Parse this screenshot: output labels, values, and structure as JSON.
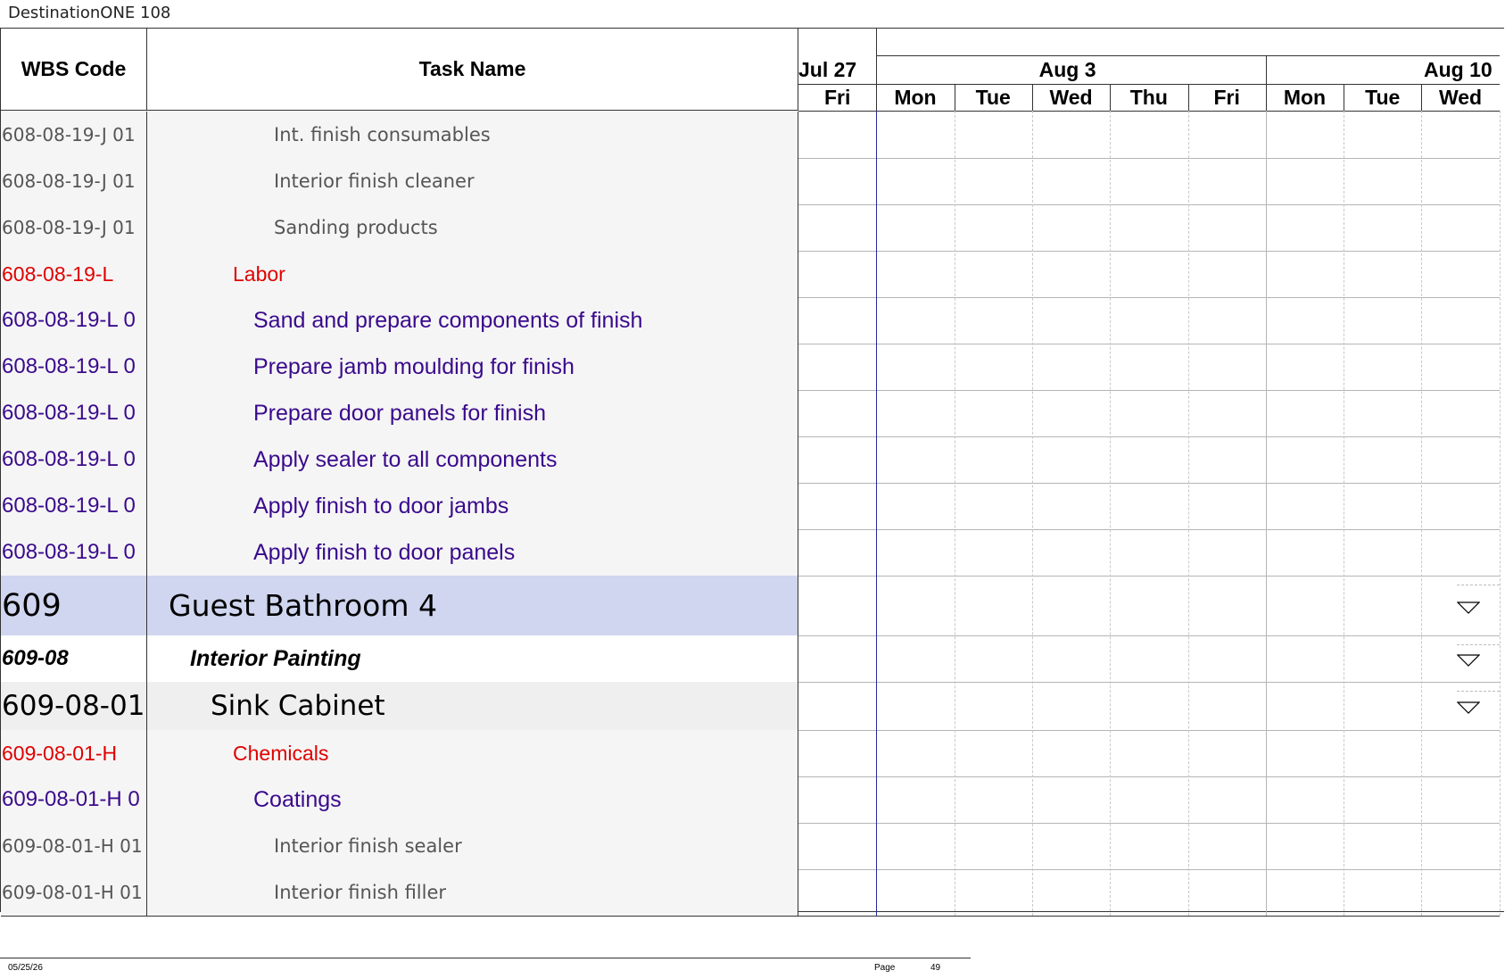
{
  "document": {
    "title": "DestinationONE 108"
  },
  "columns": {
    "wbs_header": "WBS Code",
    "task_header": "Task Name"
  },
  "timeline": {
    "weeks": [
      "Jul 27",
      "Aug 3",
      "Aug 10"
    ],
    "days": [
      "Fri",
      "Mon",
      "Tue",
      "Wed",
      "Thu",
      "Fri",
      "Mon",
      "Tue",
      "Wed"
    ]
  },
  "rows": [
    {
      "wbs": "608-08-19-J 01",
      "task": "Int. finish consumables",
      "style": "leaf",
      "collapse_icon": false
    },
    {
      "wbs": "608-08-19-J 01",
      "task": "Interior finish cleaner",
      "style": "leaf",
      "collapse_icon": false
    },
    {
      "wbs": "608-08-19-J 01",
      "task": "Sanding products",
      "style": "leaf",
      "collapse_icon": false
    },
    {
      "wbs": "608-08-19-L",
      "task": "Labor",
      "style": "category",
      "collapse_icon": false
    },
    {
      "wbs": "608-08-19-L 0",
      "task": "Sand and prepare components of finish",
      "style": "item",
      "collapse_icon": false
    },
    {
      "wbs": "608-08-19-L 0",
      "task": "Prepare jamb moulding for finish",
      "style": "item",
      "collapse_icon": false
    },
    {
      "wbs": "608-08-19-L 0",
      "task": "Prepare door panels for finish",
      "style": "item",
      "collapse_icon": false
    },
    {
      "wbs": "608-08-19-L 0",
      "task": "Apply sealer to all components",
      "style": "item",
      "collapse_icon": false
    },
    {
      "wbs": "608-08-19-L 0",
      "task": "Apply finish to door jambs",
      "style": "item",
      "collapse_icon": false
    },
    {
      "wbs": "608-08-19-L 0",
      "task": "Apply finish to door panels",
      "style": "item",
      "collapse_icon": false
    },
    {
      "wbs": "609",
      "task": "Guest Bathroom 4",
      "style": "room",
      "collapse_icon": true
    },
    {
      "wbs": "609-08",
      "task": "Interior Painting",
      "style": "phase",
      "collapse_icon": true
    },
    {
      "wbs": "609-08-01",
      "task": "Sink Cabinet",
      "style": "group",
      "collapse_icon": true
    },
    {
      "wbs": "609-08-01-H",
      "task": "Chemicals",
      "style": "category",
      "collapse_icon": false
    },
    {
      "wbs": "609-08-01-H 0",
      "task": "Coatings",
      "style": "item",
      "collapse_icon": false
    },
    {
      "wbs": "609-08-01-H 01",
      "task": "Interior finish sealer",
      "style": "leaf",
      "collapse_icon": false
    },
    {
      "wbs": "609-08-01-H 01",
      "task": "Interior finish filler",
      "style": "leaf",
      "collapse_icon": false
    }
  ],
  "colors": {
    "leaf": "#555555",
    "category": "#e00000",
    "item": "#3a0a8c",
    "room_fill": "#d0d6ef",
    "group_fill": "#efefef",
    "gridline": "#b5b5b5",
    "today_line": "#1f2a9c"
  },
  "footer": {
    "date": "05/25/26",
    "page_label": "Page",
    "page_number": "49"
  }
}
